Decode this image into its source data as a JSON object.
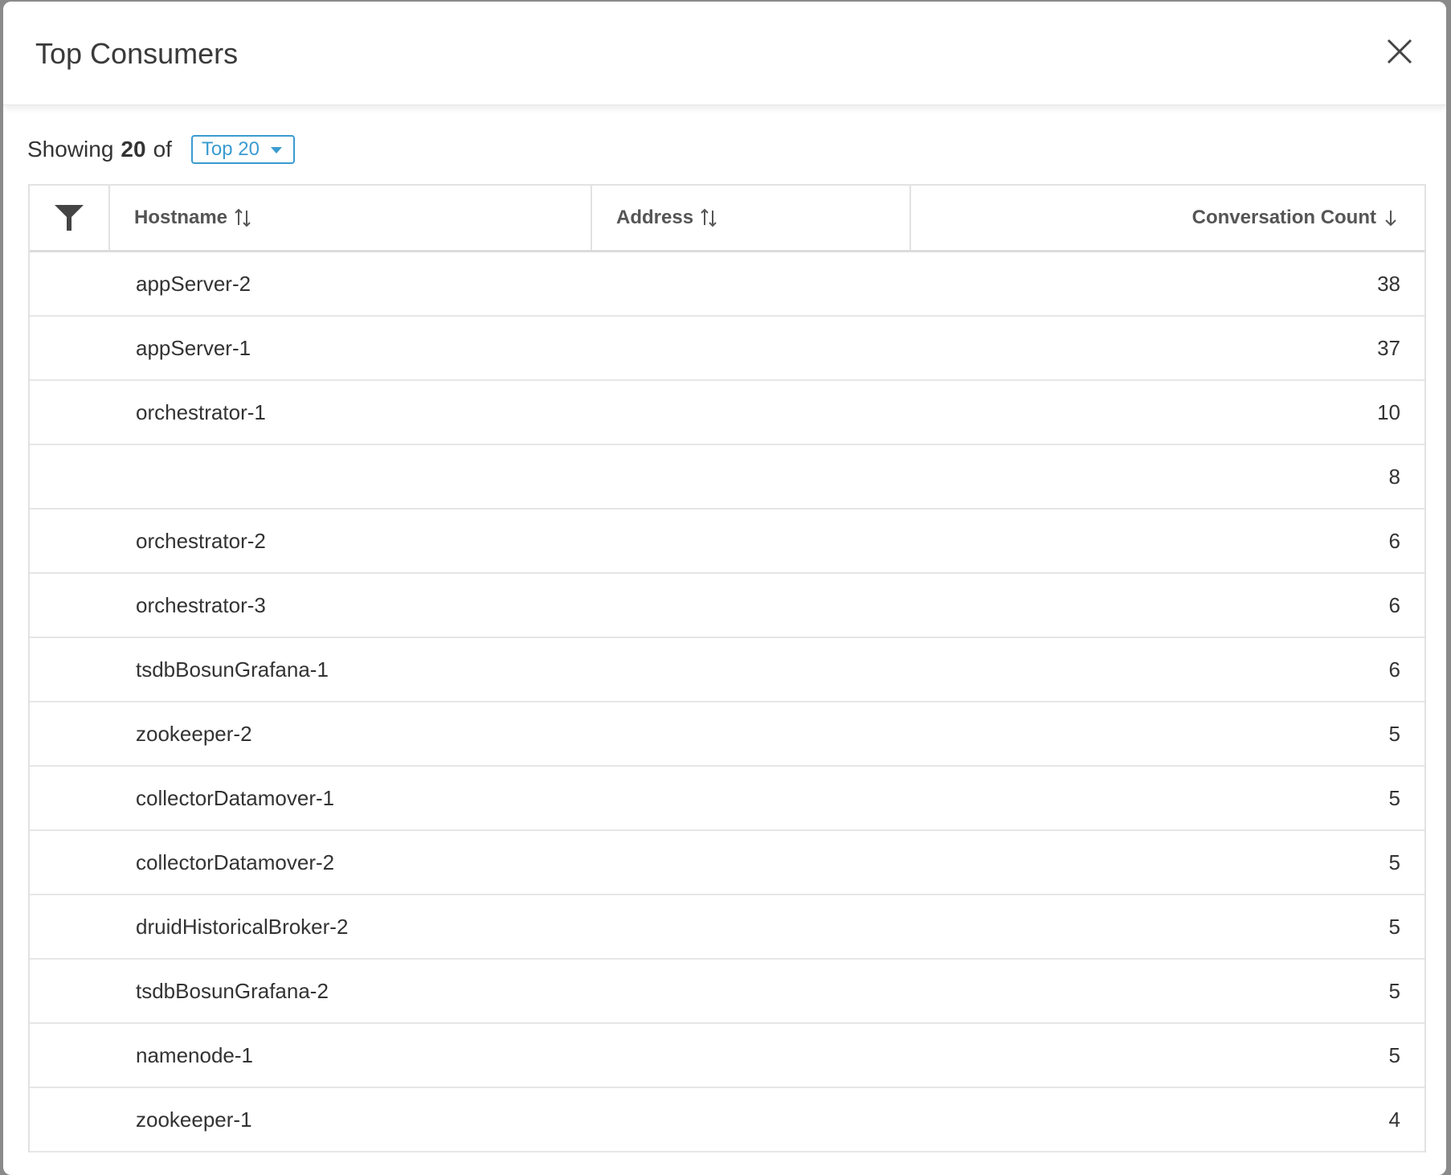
{
  "modal": {
    "title": "Top Consumers"
  },
  "summary": {
    "showing_label": "Showing",
    "count": "20",
    "of_label": "of",
    "topn_value": "Top 20"
  },
  "table": {
    "columns": {
      "hostname": "Hostname",
      "address": "Address",
      "conversation_count": "Conversation Count"
    },
    "rows": [
      {
        "hostname": "appServer-2",
        "address": "",
        "count": "38"
      },
      {
        "hostname": "appServer-1",
        "address": "",
        "count": "37"
      },
      {
        "hostname": "orchestrator-1",
        "address": "",
        "count": "10"
      },
      {
        "hostname": "",
        "address": "",
        "count": "8"
      },
      {
        "hostname": "orchestrator-2",
        "address": "",
        "count": "6"
      },
      {
        "hostname": "orchestrator-3",
        "address": "",
        "count": "6"
      },
      {
        "hostname": "tsdbBosunGrafana-1",
        "address": "",
        "count": "6"
      },
      {
        "hostname": "zookeeper-2",
        "address": "",
        "count": "5"
      },
      {
        "hostname": "collectorDatamover-1",
        "address": "",
        "count": "5"
      },
      {
        "hostname": "collectorDatamover-2",
        "address": "",
        "count": "5"
      },
      {
        "hostname": "druidHistoricalBroker-2",
        "address": "",
        "count": "5"
      },
      {
        "hostname": "tsdbBosunGrafana-2",
        "address": "",
        "count": "5"
      },
      {
        "hostname": "namenode-1",
        "address": "",
        "count": "5"
      },
      {
        "hostname": "zookeeper-1",
        "address": "",
        "count": "4"
      }
    ]
  },
  "colors": {
    "accent": "#3a9bd1",
    "border": "#e2e2e2",
    "text": "#333333"
  }
}
